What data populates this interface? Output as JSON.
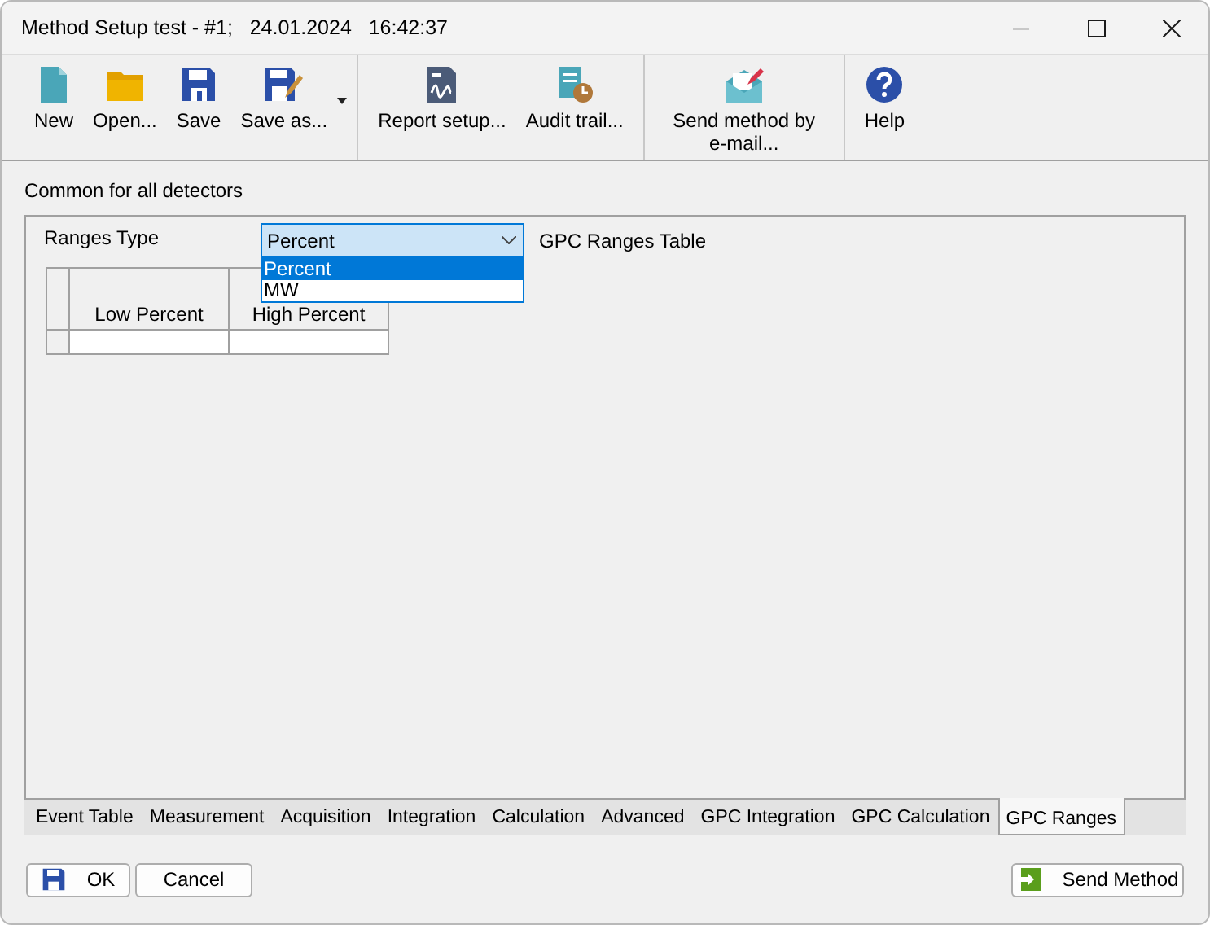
{
  "window": {
    "title": "Method Setup test - #1;   24.01.2024   16:42:37",
    "controls": [
      {
        "kind": "minimize",
        "disabled": true
      },
      {
        "kind": "maximize",
        "disabled": false
      },
      {
        "kind": "close",
        "disabled": false
      }
    ]
  },
  "toolbar": {
    "groups": [
      [
        {
          "kind": "new",
          "label": "New",
          "menu": false
        },
        {
          "kind": "open",
          "label": "Open...",
          "menu": false
        },
        {
          "kind": "save",
          "label": "Save",
          "menu": false
        },
        {
          "kind": "saveas",
          "label": "Save as...",
          "menu": true
        }
      ],
      [
        {
          "kind": "report",
          "label": "Report setup...",
          "menu": false
        },
        {
          "kind": "audit",
          "label": "Audit trail...",
          "menu": false
        }
      ],
      [
        {
          "kind": "mail",
          "label": "Send method by e-mail...",
          "menu": false
        }
      ],
      [
        {
          "kind": "help",
          "label": "Help",
          "menu": false
        }
      ]
    ]
  },
  "section_label": "Common for all detectors",
  "ranges_type": {
    "label": "Ranges Type",
    "value": "Percent",
    "expanded": true,
    "options": [
      {
        "label": "Percent",
        "selected": true
      },
      {
        "label": "MW",
        "selected": false
      }
    ]
  },
  "table_label": "GPC Ranges Table",
  "table": {
    "columns": [
      "Low Percent",
      "High Percent"
    ]
  },
  "tabs": [
    {
      "label": "Event Table",
      "selected": false
    },
    {
      "label": "Measurement",
      "selected": false
    },
    {
      "label": "Acquisition",
      "selected": false
    },
    {
      "label": "Integration",
      "selected": false
    },
    {
      "label": "Calculation",
      "selected": false
    },
    {
      "label": "Advanced",
      "selected": false
    },
    {
      "label": "GPC Integration",
      "selected": false
    },
    {
      "label": "GPC Calculation",
      "selected": false
    },
    {
      "label": "GPC Ranges",
      "selected": true
    }
  ],
  "buttons": {
    "ok": "OK",
    "cancel": "Cancel",
    "send": "Send Method"
  }
}
